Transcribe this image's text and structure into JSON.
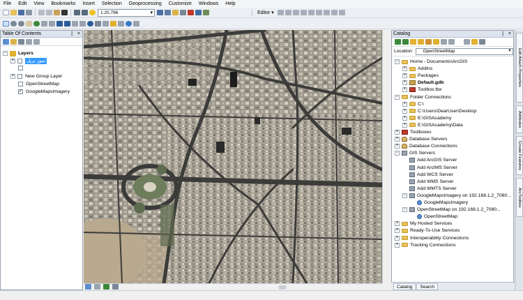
{
  "menu": [
    "File",
    "Edit",
    "View",
    "Bookmarks",
    "Insert",
    "Selection",
    "Geoprocessing",
    "Customize",
    "Windows",
    "Help"
  ],
  "toolbar": {
    "scale_value": "1:20,796",
    "editor_label": "Editor ▾"
  },
  "toc": {
    "title": "Table Of Contents",
    "pin": "❘",
    "close": "×",
    "layers_label": "Layers",
    "items": [
      {
        "label": "تمور بريل",
        "selected": true,
        "checked": false
      },
      {
        "label": "",
        "checked": false
      },
      {
        "label": "New Group Layer",
        "checked": false
      },
      {
        "label": "OpenStreetMap",
        "checked": false
      },
      {
        "label": "GoogleMapsImagery",
        "checked": true
      }
    ]
  },
  "catalog": {
    "title": "Catalog",
    "pin": "❘",
    "close": "×",
    "location_label": "Location:",
    "location_value": "OpenStreetMap",
    "tree": [
      {
        "label": "Home - Documents\\ArcGIS",
        "depth": 0,
        "icon": "folder-icon",
        "exp": "-"
      },
      {
        "label": "AddIns",
        "depth": 1,
        "icon": "folder-icon",
        "exp": "+"
      },
      {
        "label": "Packages",
        "depth": 1,
        "icon": "folder-icon",
        "exp": "+"
      },
      {
        "label": "Default.gdb",
        "depth": 1,
        "icon": "geodatabase-icon",
        "exp": "+",
        "bold": true
      },
      {
        "label": "Toolbox.tbx",
        "depth": 1,
        "icon": "toolbox-icon",
        "exp": "+"
      },
      {
        "label": "Folder Connections",
        "depth": 0,
        "icon": "folder-icon",
        "exp": "-"
      },
      {
        "label": "C:\\",
        "depth": 1,
        "icon": "folder-icon",
        "exp": "+"
      },
      {
        "label": "C:\\Users\\DearUser\\Desktop",
        "depth": 1,
        "icon": "folder-icon",
        "exp": "+"
      },
      {
        "label": "E:\\GISAcademy",
        "depth": 1,
        "icon": "folder-icon",
        "exp": "+"
      },
      {
        "label": "E:\\GISAcademy\\Data",
        "depth": 1,
        "icon": "folder-icon",
        "exp": "+"
      },
      {
        "label": "Toolboxes",
        "depth": 0,
        "icon": "toolbox-icon",
        "exp": "+"
      },
      {
        "label": "Database Servers",
        "depth": 0,
        "icon": "database-icon",
        "exp": "+"
      },
      {
        "label": "Database Connections",
        "depth": 0,
        "icon": "database-icon",
        "exp": "+"
      },
      {
        "label": "GIS Servers",
        "depth": 0,
        "icon": "server-icon",
        "exp": "-"
      },
      {
        "label": "Add ArcGIS Server",
        "depth": 1,
        "icon": "server-icon",
        "exp": ""
      },
      {
        "label": "Add ArcIMS Server",
        "depth": 1,
        "icon": "server-icon",
        "exp": ""
      },
      {
        "label": "Add WCS Server",
        "depth": 1,
        "icon": "server-icon",
        "exp": ""
      },
      {
        "label": "Add WMS Server",
        "depth": 1,
        "icon": "server-icon",
        "exp": ""
      },
      {
        "label": "Add WMTS Server",
        "depth": 1,
        "icon": "server-icon",
        "exp": ""
      },
      {
        "label": "GoogleMapsImagery on 192.168.1.2_7080...",
        "depth": 1,
        "icon": "server-icon",
        "exp": "-"
      },
      {
        "label": "GoogleMapsImagery",
        "depth": 2,
        "icon": "globe-icon",
        "exp": ""
      },
      {
        "label": "OpenStreetMap on 192.168.1.2_7080...",
        "depth": 1,
        "icon": "server-icon",
        "exp": "-"
      },
      {
        "label": "OpenStreetMap",
        "depth": 2,
        "icon": "globe-icon",
        "exp": ""
      },
      {
        "label": "My Hosted Services",
        "depth": 0,
        "icon": "folder-icon",
        "exp": "+"
      },
      {
        "label": "Ready-To-Use Services",
        "depth": 0,
        "icon": "folder-icon",
        "exp": "+"
      },
      {
        "label": "Interoperability Connections",
        "depth": 0,
        "icon": "folder-icon",
        "exp": "+"
      },
      {
        "label": "Tracking Connections",
        "depth": 0,
        "icon": "folder-icon",
        "exp": "+"
      }
    ],
    "tabs": [
      "Catalog",
      "Search"
    ]
  },
  "side_tabs": [
    "Edit Attach Properties",
    "Attributes",
    "Create Features",
    "ArcToolbox"
  ]
}
